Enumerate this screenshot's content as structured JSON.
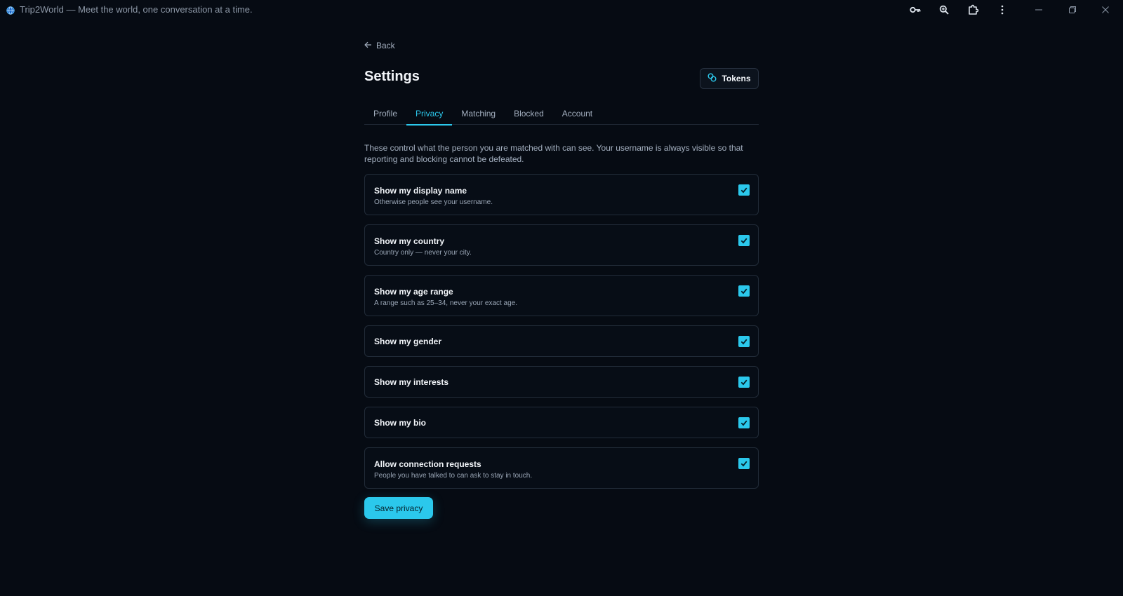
{
  "window": {
    "title": "Trip2World — Meet the world, one conversation at a time."
  },
  "colors": {
    "background": "#060b13",
    "accent": "#2bc8ec",
    "border": "#222c39"
  },
  "nav": {
    "back_label": "Back"
  },
  "page": {
    "title": "Settings",
    "tokens_label": "Tokens"
  },
  "tabs": [
    {
      "label": "Profile",
      "active": false
    },
    {
      "label": "Privacy",
      "active": true
    },
    {
      "label": "Matching",
      "active": false
    },
    {
      "label": "Blocked",
      "active": false
    },
    {
      "label": "Account",
      "active": false
    }
  ],
  "privacy": {
    "intro": "These control what the person you are matched with can see. Your username is always visible so that reporting and blocking cannot be defeated.",
    "options": [
      {
        "title": "Show my display name",
        "description": "Otherwise people see your username.",
        "checked": true
      },
      {
        "title": "Show my country",
        "description": "Country only — never your city.",
        "checked": true
      },
      {
        "title": "Show my age range",
        "description": "A range such as 25–34, never your exact age.",
        "checked": true
      },
      {
        "title": "Show my gender",
        "description": "",
        "checked": true
      },
      {
        "title": "Show my interests",
        "description": "",
        "checked": true
      },
      {
        "title": "Show my bio",
        "description": "",
        "checked": true
      },
      {
        "title": "Allow connection requests",
        "description": "People you have talked to can ask to stay in touch.",
        "checked": true
      }
    ],
    "save_label": "Save privacy"
  }
}
